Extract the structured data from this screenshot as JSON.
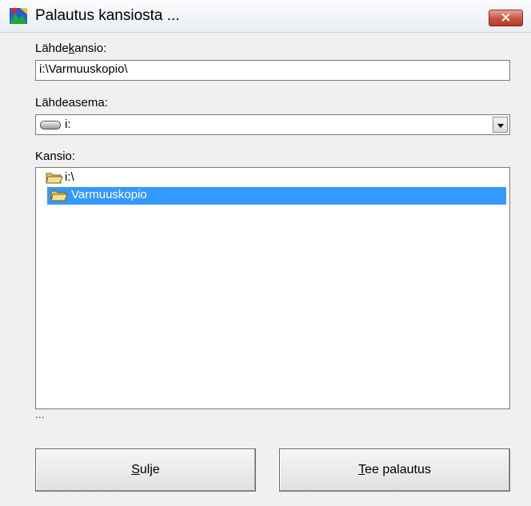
{
  "window": {
    "title": "Palautus kansiosta ...",
    "close_label": "×"
  },
  "source_folder": {
    "label_before": "Lähde",
    "label_mnemonic": "k",
    "label_after": "ansio:",
    "value": "i:\\Varmuuskopio\\"
  },
  "source_drive": {
    "label": "Lähdeasema:",
    "selected": "i:"
  },
  "folder_tree": {
    "label": "Kansio:",
    "items": [
      {
        "label": "i:\\",
        "selected": false
      },
      {
        "label": "Varmuuskopio",
        "selected": true
      }
    ],
    "status": "..."
  },
  "buttons": {
    "close_mnemonic": "S",
    "close_rest": "ulje",
    "restore_mnemonic": "T",
    "restore_rest": "ee palautus"
  },
  "colors": {
    "selection": "#3399ff",
    "window_bg": "#f0f0f0",
    "close_button": "#c8513d"
  }
}
